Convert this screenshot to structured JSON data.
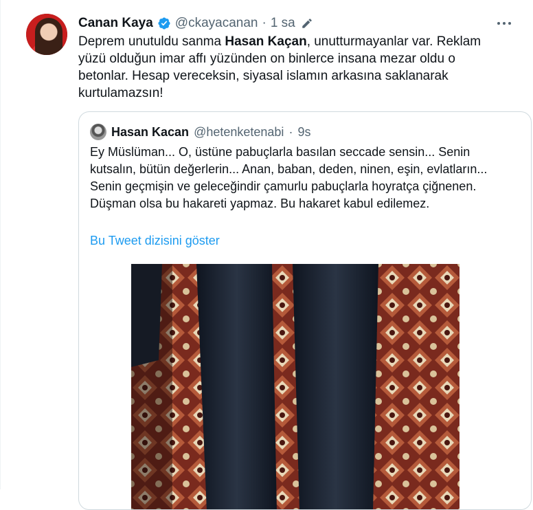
{
  "author": {
    "name": "Canan Kaya",
    "handle": "@ckayacanan",
    "separator": "·",
    "time": "1 sa",
    "avatar_icon": "profile-photo",
    "verified_icon": "verified-badge-icon",
    "verified_color": "#1d9bf0"
  },
  "tweet": {
    "text_before": "Deprem unutuldu sanma ",
    "text_bold": "Hasan Kaçan",
    "text_after": ", unutturmayanlar var. Reklam yüzü olduğun imar affı yüzünden on binlerce insana mezar oldu o betonlar. Hesap vereceksin, siyasal islamın arkasına saklanarak kurtulamazsın!"
  },
  "quoted": {
    "name": "Hasan Kacan",
    "handle": "@hetenketenabi",
    "separator": "·",
    "time": "9s",
    "text": "Ey Müslüman... O, üstüne pabuçlarla basılan seccade sensin... Senin kutsalın, bütün değerlerin... Anan, baban, deden, ninen, eşin, evlatların... Senin geçmişin ve geleceğindir çamurlu pabuçlarla hoyratça çiğnenen. Düşman olsa bu hakareti yapmaz. Bu hakaret kabul edilemez.",
    "show_thread": "Bu Tweet dizisini göster",
    "link_color": "#1d9bf0"
  }
}
